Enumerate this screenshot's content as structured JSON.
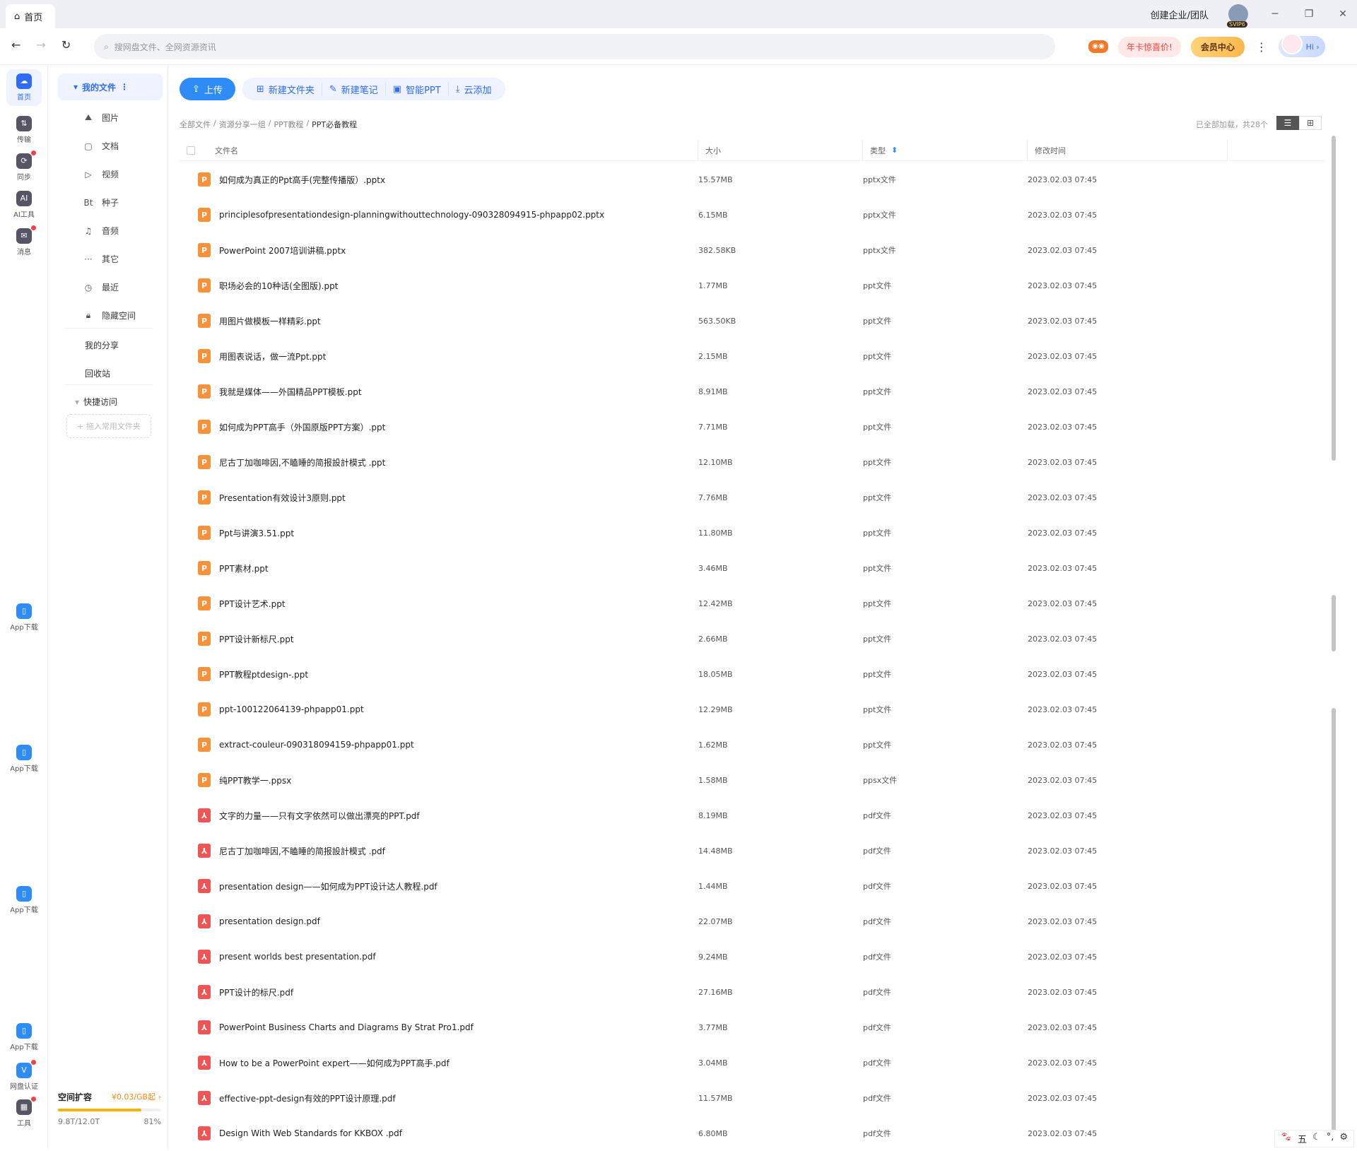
{
  "titlebar": {
    "home_tab": "首页",
    "org_link": "创建企业/团队",
    "svip_badge": "SVIP6"
  },
  "navbar": {
    "search_placeholder": "搜网盘文件、全网资源资讯",
    "promo": "年卡惊喜价!",
    "vip_center": "会员中心",
    "hi": "Hi ›"
  },
  "rail": {
    "items": [
      {
        "label": "首页",
        "icon": "home-cloud-icon"
      },
      {
        "label": "传输",
        "icon": "transfer-icon"
      },
      {
        "label": "同步",
        "icon": "sync-icon"
      },
      {
        "label": "AI工具",
        "icon": "ai-icon"
      },
      {
        "label": "消息",
        "icon": "message-icon"
      }
    ],
    "app_download": "App下载",
    "netdisk_cert": "网盘认证",
    "tools": "工具"
  },
  "sidenav": {
    "my_files": "我的文件",
    "categories": [
      {
        "label": "图片",
        "icon": "image-icon"
      },
      {
        "label": "文档",
        "icon": "document-icon"
      },
      {
        "label": "视频",
        "icon": "video-icon"
      },
      {
        "label": "种子",
        "icon": "torrent-icon"
      },
      {
        "label": "音频",
        "icon": "audio-icon"
      },
      {
        "label": "其它",
        "icon": "other-icon"
      },
      {
        "label": "最近",
        "icon": "recent-icon"
      },
      {
        "label": "隐藏空间",
        "icon": "lock-icon"
      }
    ],
    "my_share": "我的分享",
    "recycle": "回收站",
    "quick_access": "快捷访问",
    "quick_drop": "+ 拖入常用文件夹",
    "storage": {
      "title": "空间扩容",
      "price": "¥0.03/GB起 ›",
      "used": "9.8T/12.0T",
      "percent": "81%",
      "fill": 0.81
    }
  },
  "toolbar": {
    "upload": "上传",
    "new_folder": "新建文件夹",
    "new_note": "新建笔记",
    "smart_ppt": "智能PPT",
    "cloud_add": "云添加"
  },
  "breadcrumb": [
    "全部文件",
    "资源分享一组",
    "PPT教程",
    "PPT必备教程"
  ],
  "loaded_text": "已全部加载，共28个",
  "table": {
    "headers": {
      "name": "文件名",
      "size": "大小",
      "type": "类型",
      "modified": "修改时间"
    },
    "rows": [
      {
        "name": "如何成为真正的Ppt高手(完整传播版）.pptx",
        "size": "15.57MB",
        "type": "pptx文件",
        "time": "2023.02.03 07:45",
        "kind": "ppt"
      },
      {
        "name": "principlesofpresentationdesign-planningwithouttechnology-090328094915-phpapp02.pptx",
        "size": "6.15MB",
        "type": "pptx文件",
        "time": "2023.02.03 07:45",
        "kind": "ppt"
      },
      {
        "name": "PowerPoint 2007培训讲稿.pptx",
        "size": "382.58KB",
        "type": "pptx文件",
        "time": "2023.02.03 07:45",
        "kind": "ppt"
      },
      {
        "name": "职场必会的10种话(全图版).ppt",
        "size": "1.77MB",
        "type": "ppt文件",
        "time": "2023.02.03 07:45",
        "kind": "ppt"
      },
      {
        "name": "用图片做模板一样精彩.ppt",
        "size": "563.50KB",
        "type": "ppt文件",
        "time": "2023.02.03 07:45",
        "kind": "ppt"
      },
      {
        "name": "用图表说话，做一流Ppt.ppt",
        "size": "2.15MB",
        "type": "ppt文件",
        "time": "2023.02.03 07:45",
        "kind": "ppt"
      },
      {
        "name": "我就是媒体——外国精品PPT模板.ppt",
        "size": "8.91MB",
        "type": "ppt文件",
        "time": "2023.02.03 07:45",
        "kind": "ppt"
      },
      {
        "name": "如何成为PPT高手（外国原版PPT方案）.ppt",
        "size": "7.71MB",
        "type": "ppt文件",
        "time": "2023.02.03 07:45",
        "kind": "ppt"
      },
      {
        "name": "尼古丁加咖啡因,不瞌睡的简报設計模式 .ppt",
        "size": "12.10MB",
        "type": "ppt文件",
        "time": "2023.02.03 07:45",
        "kind": "ppt"
      },
      {
        "name": "Presentation有效设计3原则.ppt",
        "size": "7.76MB",
        "type": "ppt文件",
        "time": "2023.02.03 07:45",
        "kind": "ppt"
      },
      {
        "name": "Ppt与讲演3.51.ppt",
        "size": "11.80MB",
        "type": "ppt文件",
        "time": "2023.02.03 07:45",
        "kind": "ppt"
      },
      {
        "name": "PPT素材.ppt",
        "size": "3.46MB",
        "type": "ppt文件",
        "time": "2023.02.03 07:45",
        "kind": "ppt"
      },
      {
        "name": "PPT设计艺术.ppt",
        "size": "12.42MB",
        "type": "ppt文件",
        "time": "2023.02.03 07:45",
        "kind": "ppt"
      },
      {
        "name": "PPT设计新标尺.ppt",
        "size": "2.66MB",
        "type": "ppt文件",
        "time": "2023.02.03 07:45",
        "kind": "ppt"
      },
      {
        "name": "PPT教程ptdesign-.ppt",
        "size": "18.05MB",
        "type": "ppt文件",
        "time": "2023.02.03 07:45",
        "kind": "ppt"
      },
      {
        "name": "ppt-100122064139-phpapp01.ppt",
        "size": "12.29MB",
        "type": "ppt文件",
        "time": "2023.02.03 07:45",
        "kind": "ppt"
      },
      {
        "name": "extract-couleur-090318094159-phpapp01.ppt",
        "size": "1.62MB",
        "type": "ppt文件",
        "time": "2023.02.03 07:45",
        "kind": "ppt"
      },
      {
        "name": "纯PPT教学一.ppsx",
        "size": "1.58MB",
        "type": "ppsx文件",
        "time": "2023.02.03 07:45",
        "kind": "ppt"
      },
      {
        "name": "文字的力量——只有文字依然可以做出漂亮的PPT.pdf",
        "size": "8.19MB",
        "type": "pdf文件",
        "time": "2023.02.03 07:45",
        "kind": "pdf"
      },
      {
        "name": "尼古丁加咖啡因,不瞌睡的简报設計模式 .pdf",
        "size": "14.48MB",
        "type": "pdf文件",
        "time": "2023.02.03 07:45",
        "kind": "pdf"
      },
      {
        "name": "presentation design——如何成为PPT设计达人教程.pdf",
        "size": "1.44MB",
        "type": "pdf文件",
        "time": "2023.02.03 07:45",
        "kind": "pdf"
      },
      {
        "name": "presentation design.pdf",
        "size": "22.07MB",
        "type": "pdf文件",
        "time": "2023.02.03 07:45",
        "kind": "pdf"
      },
      {
        "name": "present   worlds   best   presentation.pdf",
        "size": "9.24MB",
        "type": "pdf文件",
        "time": "2023.02.03 07:45",
        "kind": "pdf"
      },
      {
        "name": "PPT设计的标尺.pdf",
        "size": "27.16MB",
        "type": "pdf文件",
        "time": "2023.02.03 07:45",
        "kind": "pdf"
      },
      {
        "name": "PowerPoint Business Charts and Diagrams By Strat Pro1.pdf",
        "size": "3.77MB",
        "type": "pdf文件",
        "time": "2023.02.03 07:45",
        "kind": "pdf"
      },
      {
        "name": "How to be a PowerPoint expert——如何成为PPT高手.pdf",
        "size": "3.04MB",
        "type": "pdf文件",
        "time": "2023.02.03 07:45",
        "kind": "pdf"
      },
      {
        "name": "effective-ppt-design有效的PPT设计原理.pdf",
        "size": "11.57MB",
        "type": "pdf文件",
        "time": "2023.02.03 07:45",
        "kind": "pdf"
      },
      {
        "name": "Design With Web Standards for KKBOX .pdf",
        "size": "6.80MB",
        "type": "pdf文件",
        "time": "2023.02.03 07:45",
        "kind": "pdf"
      }
    ]
  },
  "ime": [
    "五"
  ]
}
